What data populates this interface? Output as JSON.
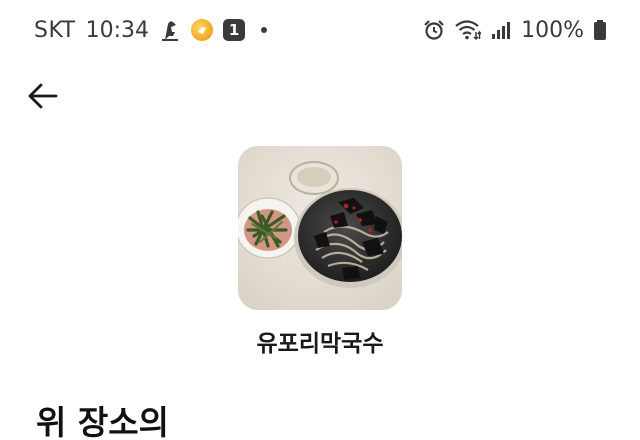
{
  "status_bar": {
    "carrier": "SKT",
    "time": "10:34",
    "notification_badge": "1",
    "battery_percent": "100%"
  },
  "top_bar": {
    "back_icon": "arrow-left-icon"
  },
  "place": {
    "name": "유포리막국수",
    "thumbnail": "food-photo"
  },
  "section": {
    "heading": "위 장소의"
  },
  "colors": {
    "text_primary": "#1a1a1a",
    "status_text": "#3a3a3a",
    "background": "#ffffff"
  }
}
